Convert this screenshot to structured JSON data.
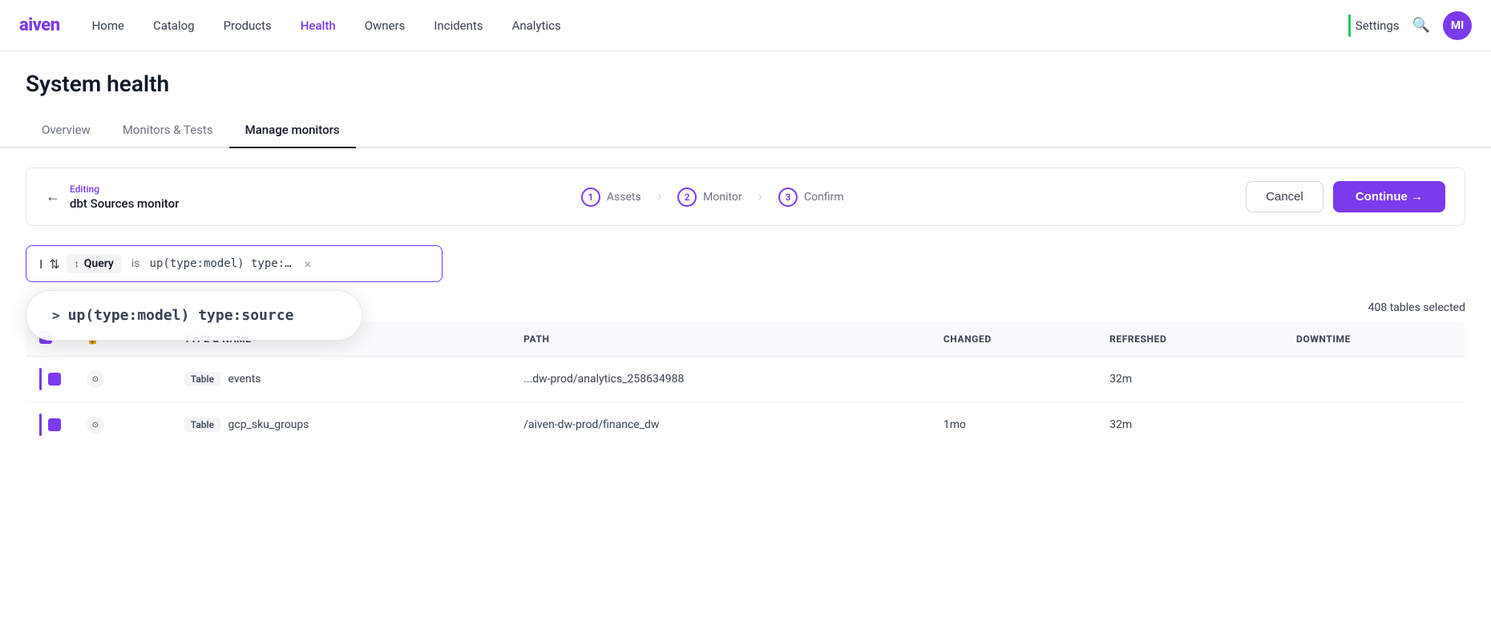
{
  "nav": {
    "logo": "aiven",
    "links": [
      {
        "label": "Home",
        "active": false
      },
      {
        "label": "Catalog",
        "active": false
      },
      {
        "label": "Products",
        "active": false
      },
      {
        "label": "Health",
        "active": true
      },
      {
        "label": "Owners",
        "active": false
      },
      {
        "label": "Incidents",
        "active": false
      },
      {
        "label": "Analytics",
        "active": false
      }
    ],
    "settings_label": "Settings",
    "avatar_initials": "MI"
  },
  "page": {
    "title": "System health"
  },
  "tabs": [
    {
      "label": "Overview",
      "active": false
    },
    {
      "label": "Monitors & Tests",
      "active": false
    },
    {
      "label": "Manage monitors",
      "active": true
    }
  ],
  "editing": {
    "label": "Editing",
    "name": "dbt Sources monitor",
    "steps": [
      {
        "num": "1",
        "name": "Assets"
      },
      {
        "num": "2",
        "name": "Monitor"
      },
      {
        "num": "3",
        "name": "Confirm"
      }
    ],
    "cancel_label": "Cancel",
    "continue_label": "Continue →"
  },
  "search": {
    "cursor": "I",
    "query_icon": "↕",
    "query_tag": "Query",
    "query_is": "is",
    "query_value": "up(type:model) type:…",
    "close_icon": "×",
    "dropdown_chevron": ">",
    "dropdown_value": "up(type:model) type:source"
  },
  "table": {
    "selected_count": "408 tables selected",
    "columns": [
      {
        "label": ""
      },
      {
        "label": "🔒"
      },
      {
        "label": "TYPE & NAME"
      },
      {
        "label": "PATH"
      },
      {
        "label": "CHANGED"
      },
      {
        "label": "REFRESHED"
      },
      {
        "label": "DOWNTIME"
      }
    ],
    "rows": [
      {
        "type": "Table",
        "name": "events",
        "path": "...dw-prod/analytics_258634988",
        "changed": "",
        "refreshed": "32m",
        "downtime": ""
      },
      {
        "type": "Table",
        "name": "gcp_sku_groups",
        "path": "/aiven-dw-prod/finance_dw",
        "changed": "1mo",
        "refreshed": "32m",
        "downtime": ""
      }
    ]
  }
}
